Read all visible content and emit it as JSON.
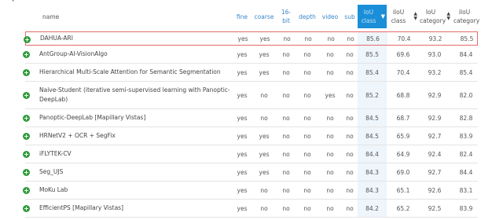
{
  "section": {
    "title": ""
  },
  "columns": {
    "name": "name",
    "fine": "fine",
    "coarse": "coarse",
    "bit16": "16-bit",
    "depth": "depth",
    "video": "video",
    "sub": "sub",
    "iou_class": "IoU class",
    "iiou_class": "iIoU class",
    "iou_category": "IoU category",
    "iiou_category": "iIoU category"
  },
  "colors": {
    "sorted_header": "#1b8ed8",
    "highlight_border": "#e56b6b",
    "expand_icon": "#2f9a3c",
    "link_header": "#3a86c8"
  },
  "rows": [
    {
      "name": "DAHUA-ARI",
      "fine": "yes",
      "coarse": "yes",
      "bit16": "no",
      "depth": "no",
      "video": "no",
      "sub": "no",
      "iou_class": "85.6",
      "iiou_class": "70.4",
      "iou_category": "93.2",
      "iiou_category": "85.5"
    },
    {
      "name": "AntGroup-AI-VisionAlgo",
      "fine": "yes",
      "coarse": "yes",
      "bit16": "no",
      "depth": "no",
      "video": "no",
      "sub": "no",
      "iou_class": "85.5",
      "iiou_class": "69.6",
      "iou_category": "93.0",
      "iiou_category": "84.4"
    },
    {
      "name": "Hierarchical Multi-Scale Attention for Semantic Segmentation",
      "fine": "yes",
      "coarse": "yes",
      "bit16": "no",
      "depth": "no",
      "video": "no",
      "sub": "no",
      "iou_class": "85.4",
      "iiou_class": "70.4",
      "iou_category": "93.2",
      "iiou_category": "85.4"
    },
    {
      "name": "Naive-Student (iterative semi-supervised learning with Panoptic-DeepLab)",
      "fine": "yes",
      "coarse": "no",
      "bit16": "no",
      "depth": "no",
      "video": "yes",
      "sub": "no",
      "iou_class": "85.2",
      "iiou_class": "68.8",
      "iou_category": "92.9",
      "iiou_category": "82.0"
    },
    {
      "name": "Panoptic-DeepLab [Mapillary Vistas]",
      "fine": "yes",
      "coarse": "no",
      "bit16": "no",
      "depth": "no",
      "video": "no",
      "sub": "no",
      "iou_class": "84.5",
      "iiou_class": "68.7",
      "iou_category": "92.9",
      "iiou_category": "82.8"
    },
    {
      "name": "HRNetV2 + OCR + SegFix",
      "fine": "yes",
      "coarse": "yes",
      "bit16": "no",
      "depth": "no",
      "video": "no",
      "sub": "no",
      "iou_class": "84.5",
      "iiou_class": "65.9",
      "iou_category": "92.7",
      "iiou_category": "83.9"
    },
    {
      "name": "iFLYTEK-CV",
      "fine": "yes",
      "coarse": "yes",
      "bit16": "no",
      "depth": "no",
      "video": "no",
      "sub": "no",
      "iou_class": "84.4",
      "iiou_class": "64.9",
      "iou_category": "92.4",
      "iiou_category": "82.4"
    },
    {
      "name": "Seg_UJS",
      "fine": "yes",
      "coarse": "yes",
      "bit16": "no",
      "depth": "no",
      "video": "no",
      "sub": "no",
      "iou_class": "84.3",
      "iiou_class": "69.0",
      "iou_category": "92.7",
      "iiou_category": "84.4"
    },
    {
      "name": "MoKu Lab",
      "fine": "yes",
      "coarse": "no",
      "bit16": "no",
      "depth": "no",
      "video": "no",
      "sub": "no",
      "iou_class": "84.3",
      "iiou_class": "65.1",
      "iou_category": "92.6",
      "iiou_category": "83.1"
    },
    {
      "name": "EfficientPS [Mapillary Vistas]",
      "fine": "yes",
      "coarse": "no",
      "bit16": "no",
      "depth": "no",
      "video": "no",
      "sub": "no",
      "iou_class": "84.2",
      "iiou_class": "65.2",
      "iou_category": "92.5",
      "iiou_category": "83.9"
    }
  ]
}
